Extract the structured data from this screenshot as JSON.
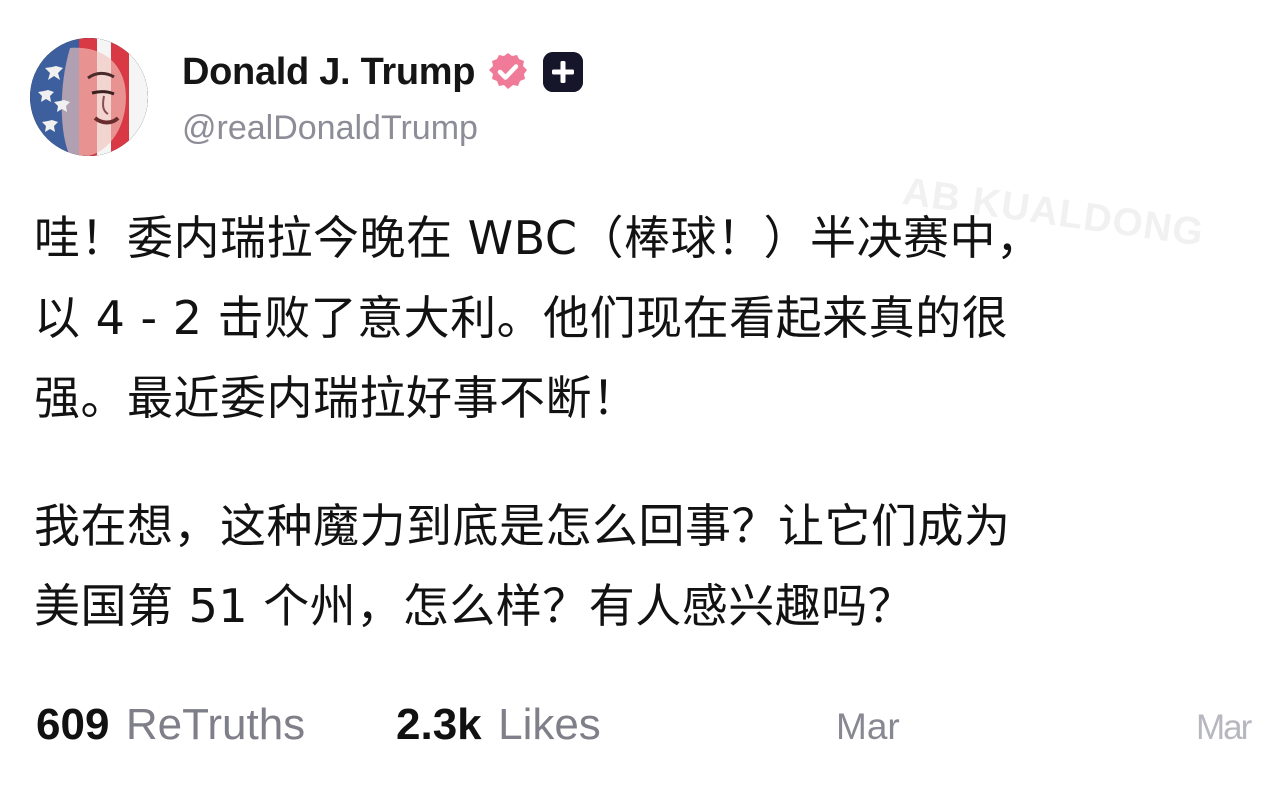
{
  "profile": {
    "display_name": "Donald J. Trump",
    "handle": "@realDonaldTrump",
    "verified_icon": "verified-badge-icon",
    "plus_icon": "plus-badge-icon",
    "accent_color": "#f07b98",
    "badge_color": "#16162a"
  },
  "watermark": {
    "text": "AB KUALDONG"
  },
  "post": {
    "paragraphs": [
      "哇！委内瑞拉今晚在 WBC（棒球！）半决赛中，\n以 4 - 2 击败了意大利。他们现在看起来真的很\n强。最近委内瑞拉好事不断！",
      "我在想，这种魔力到底是怎么回事？让它们成为\n美国第 51 个州，怎么样？有人感兴趣吗？"
    ]
  },
  "stats": {
    "retruths_count": "609",
    "retruths_label": "ReTruths",
    "likes_count": "2.3k",
    "likes_label": "Likes",
    "date": "Mar",
    "date_ghost": "Mar"
  }
}
